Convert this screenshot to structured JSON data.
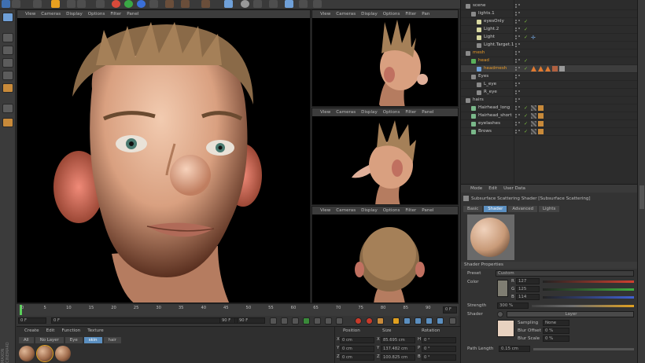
{
  "toolbar": {
    "colors": {
      "move": "#e8a020",
      "axis_x": "#d84a3a",
      "axis_y": "#3aa845",
      "axis_z": "#3a6fd8",
      "cube": "#6fa0d8",
      "sphere": "#999999"
    }
  },
  "viewport_main": {
    "menu": [
      "View",
      "Cameras",
      "Display",
      "Options",
      "Filter",
      "Panel"
    ]
  },
  "viewport_small": [
    {
      "menu": [
        "View",
        "Cameras",
        "Display",
        "Options",
        "Filter",
        "Pan"
      ]
    },
    {
      "menu": [
        "View",
        "Cameras",
        "Display",
        "Options",
        "Filter",
        "Panel"
      ]
    },
    {
      "menu": [
        "View",
        "Cameras",
        "Display",
        "Options",
        "Filter",
        "Panel"
      ]
    }
  ],
  "timeline": {
    "ticks": [
      "0",
      "5",
      "10",
      "15",
      "20",
      "25",
      "30",
      "35",
      "40",
      "45",
      "50",
      "55",
      "60",
      "65",
      "70",
      "75",
      "80",
      "85",
      "90"
    ],
    "frame_readout": "0 F",
    "start_field": "0 F",
    "current_field": "0 F",
    "end_field": "90 F",
    "end_field_b": "90 F"
  },
  "material_manager": {
    "menu": [
      "Create",
      "Edit",
      "Function",
      "Texture"
    ],
    "tabs": [
      {
        "label": "All",
        "active": false
      },
      {
        "label": "No Layer",
        "active": false
      },
      {
        "label": "Eye",
        "active": false
      },
      {
        "label": "skin",
        "active": true
      },
      {
        "label": "hair",
        "active": false
      }
    ],
    "side_brand": "MAXON CINEMA4D"
  },
  "coordinates": {
    "headers": [
      "Position",
      "Size",
      "Rotation"
    ],
    "rows": [
      {
        "axis": "X",
        "pos": "0 cm",
        "size": "85.695 cm",
        "rot_label": "H",
        "rot": "0 °"
      },
      {
        "axis": "Y",
        "pos": "0 cm",
        "size": "137.482 cm",
        "rot_label": "P",
        "rot": "0 °"
      },
      {
        "axis": "Z",
        "pos": "0 cm",
        "size": "100.825 cm",
        "rot_label": "B",
        "rot": "0 °"
      }
    ]
  },
  "object_manager": {
    "rows": [
      {
        "name": "scene",
        "indent": 0,
        "color": "#c8c8c8",
        "icon": "null-icon",
        "selected": false,
        "check": false
      },
      {
        "name": "lights.1",
        "indent": 1,
        "color": "#c8c8c8",
        "icon": "null-icon",
        "selected": false,
        "check": false
      },
      {
        "name": "eyesOnly",
        "indent": 2,
        "color": "#c8c8c8",
        "icon": "light-icon",
        "selected": false,
        "check": true
      },
      {
        "name": "Light.2",
        "indent": 2,
        "color": "#c8c8c8",
        "icon": "light-icon",
        "selected": false,
        "check": true
      },
      {
        "name": "Light",
        "indent": 2,
        "color": "#c8c8c8",
        "icon": "light-icon",
        "selected": false,
        "check": true
      },
      {
        "name": "Light.Target.1",
        "indent": 2,
        "color": "#c8c8c8",
        "icon": "null-icon",
        "selected": false,
        "check": false
      },
      {
        "name": "mesh",
        "indent": 0,
        "color": "#e89a28",
        "icon": "null-icon",
        "selected": false,
        "check": false
      },
      {
        "name": "head",
        "indent": 1,
        "color": "#e89a28",
        "icon": "object-icon",
        "selected": false,
        "check": true
      },
      {
        "name": "headmesh",
        "indent": 2,
        "color": "#e89a28",
        "icon": "polygon-icon",
        "selected": true,
        "check": true
      },
      {
        "name": "Eyes",
        "indent": 1,
        "color": "#c8c8c8",
        "icon": "null-icon",
        "selected": false,
        "check": false
      },
      {
        "name": "L_eye",
        "indent": 2,
        "color": "#c8c8c8",
        "icon": "null-icon",
        "selected": false,
        "check": false
      },
      {
        "name": "R_eye",
        "indent": 2,
        "color": "#c8c8c8",
        "icon": "null-icon",
        "selected": false,
        "check": false
      },
      {
        "name": "hairs",
        "indent": 0,
        "color": "#c8c8c8",
        "icon": "null-icon",
        "selected": false,
        "check": false
      },
      {
        "name": "Hairhead_long",
        "indent": 1,
        "color": "#c8c8c8",
        "icon": "hair-icon",
        "selected": false,
        "check": true
      },
      {
        "name": "Hairhead_short",
        "indent": 1,
        "color": "#c8c8c8",
        "icon": "hair-icon",
        "selected": false,
        "check": true
      },
      {
        "name": "eyelashes",
        "indent": 1,
        "color": "#c8c8c8",
        "icon": "hair-icon",
        "selected": false,
        "check": true
      },
      {
        "name": "Brows",
        "indent": 1,
        "color": "#c8c8c8",
        "icon": "hair-icon",
        "selected": false,
        "check": true
      }
    ]
  },
  "attribute_manager": {
    "menu": [
      "Mode",
      "Edit",
      "User Data"
    ],
    "title": "Subsurface Scattering Shader [Subsurface Scattering]",
    "tabs": [
      {
        "label": "Basic",
        "active": false
      },
      {
        "label": "Shader",
        "active": true
      },
      {
        "label": "Advanced",
        "active": false
      },
      {
        "label": "Lights",
        "active": false
      }
    ],
    "section_title": "Shader Properties",
    "preset_label": "Preset",
    "preset_value": "Custom",
    "color_label": "Color",
    "rgb": [
      {
        "ch": "R",
        "value": "127",
        "color": "#d04030"
      },
      {
        "ch": "G",
        "value": "125",
        "color": "#40b040"
      },
      {
        "ch": "B",
        "value": "114",
        "color": "#4060d0"
      }
    ],
    "strength_label": "Strength",
    "strength_value": "300 %",
    "shader_label": "Shader",
    "layer_label": "Layer",
    "sampling_label": "Sampling",
    "sampling_value": "None",
    "blur_offset_label": "Blur Offset",
    "blur_offset_value": "0 %",
    "blur_scale_label": "Blur Scale",
    "blur_scale_value": "0 %",
    "path_length_label": "Path Length",
    "path_length_value": "0.15 cm"
  }
}
